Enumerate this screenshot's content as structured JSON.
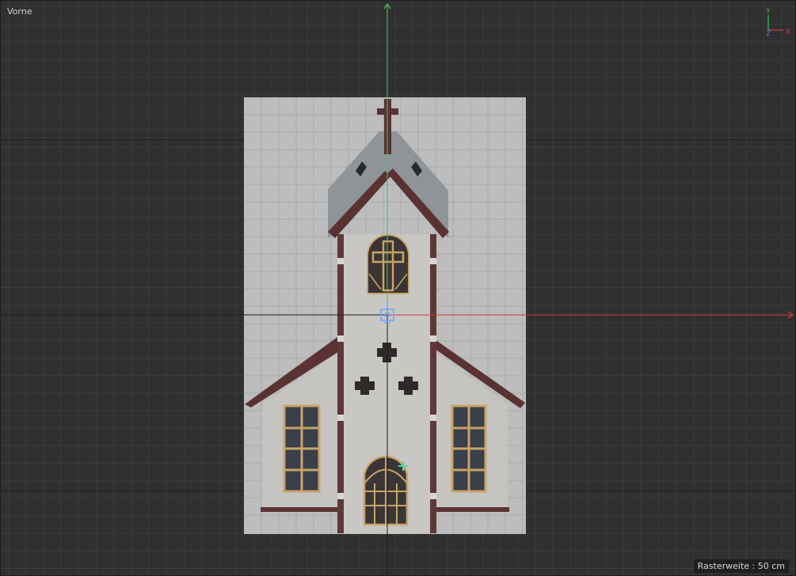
{
  "viewport": {
    "view_name": "Vorne",
    "grid_info": "Rasterweite : 50 cm"
  },
  "axis_gizmo": {
    "x_label": "X",
    "y_label": "Y",
    "z_label": "Z"
  },
  "colors": {
    "x_axis": "#c83c3c",
    "y_axis": "#3cc85a",
    "z_axis": "#4a7ad0",
    "background": "#303030",
    "selection_handle": "#6aa6ff",
    "pivot_cursor": "#3de0a8"
  },
  "scene": {
    "object": "church-model",
    "pivot": "object-axis-handle"
  }
}
